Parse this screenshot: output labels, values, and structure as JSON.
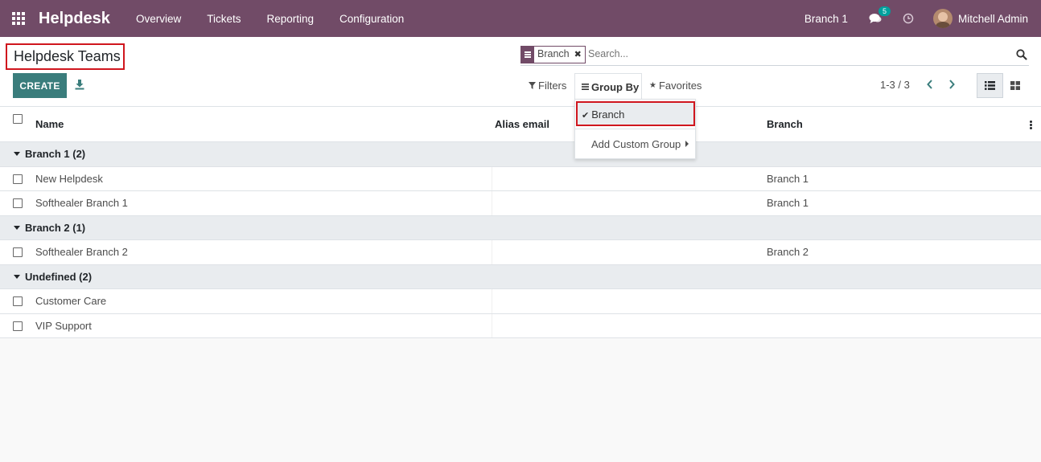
{
  "navbar": {
    "app_title": "Helpdesk",
    "menu": [
      "Overview",
      "Tickets",
      "Reporting",
      "Configuration"
    ],
    "current_branch": "Branch 1",
    "messages_count": "5",
    "user_name": "Mitchell Admin",
    "bg_color": "#714B67"
  },
  "control": {
    "page_title": "Helpdesk Teams",
    "create_label": "CREATE",
    "search": {
      "facet_value": "Branch",
      "placeholder": "Search..."
    },
    "filters_label": "Filters",
    "groupby_label": "Group By",
    "favorites_label": "Favorites",
    "pager": "1-3 / 3"
  },
  "dropdown": {
    "selected_item": "Branch",
    "custom_group_label": "Add Custom Group"
  },
  "table": {
    "columns": [
      "Name",
      "Alias email",
      "Branch"
    ],
    "groups": [
      {
        "label": "Branch 1 (2)",
        "rows": [
          {
            "name": "New Helpdesk",
            "alias": "",
            "branch": "Branch 1"
          },
          {
            "name": "Softhealer Branch 1",
            "alias": "",
            "branch": "Branch 1"
          }
        ]
      },
      {
        "label": "Branch 2 (1)",
        "rows": [
          {
            "name": "Softhealer Branch 2",
            "alias": "",
            "branch": "Branch 2"
          }
        ]
      },
      {
        "label": "Undefined (2)",
        "rows": [
          {
            "name": "Customer Care",
            "alias": "",
            "branch": ""
          },
          {
            "name": "VIP Support",
            "alias": "",
            "branch": ""
          }
        ]
      }
    ]
  },
  "colors": {
    "primary": "#714B67",
    "accent": "#00A09D",
    "highlight_border": "#D0161E"
  }
}
